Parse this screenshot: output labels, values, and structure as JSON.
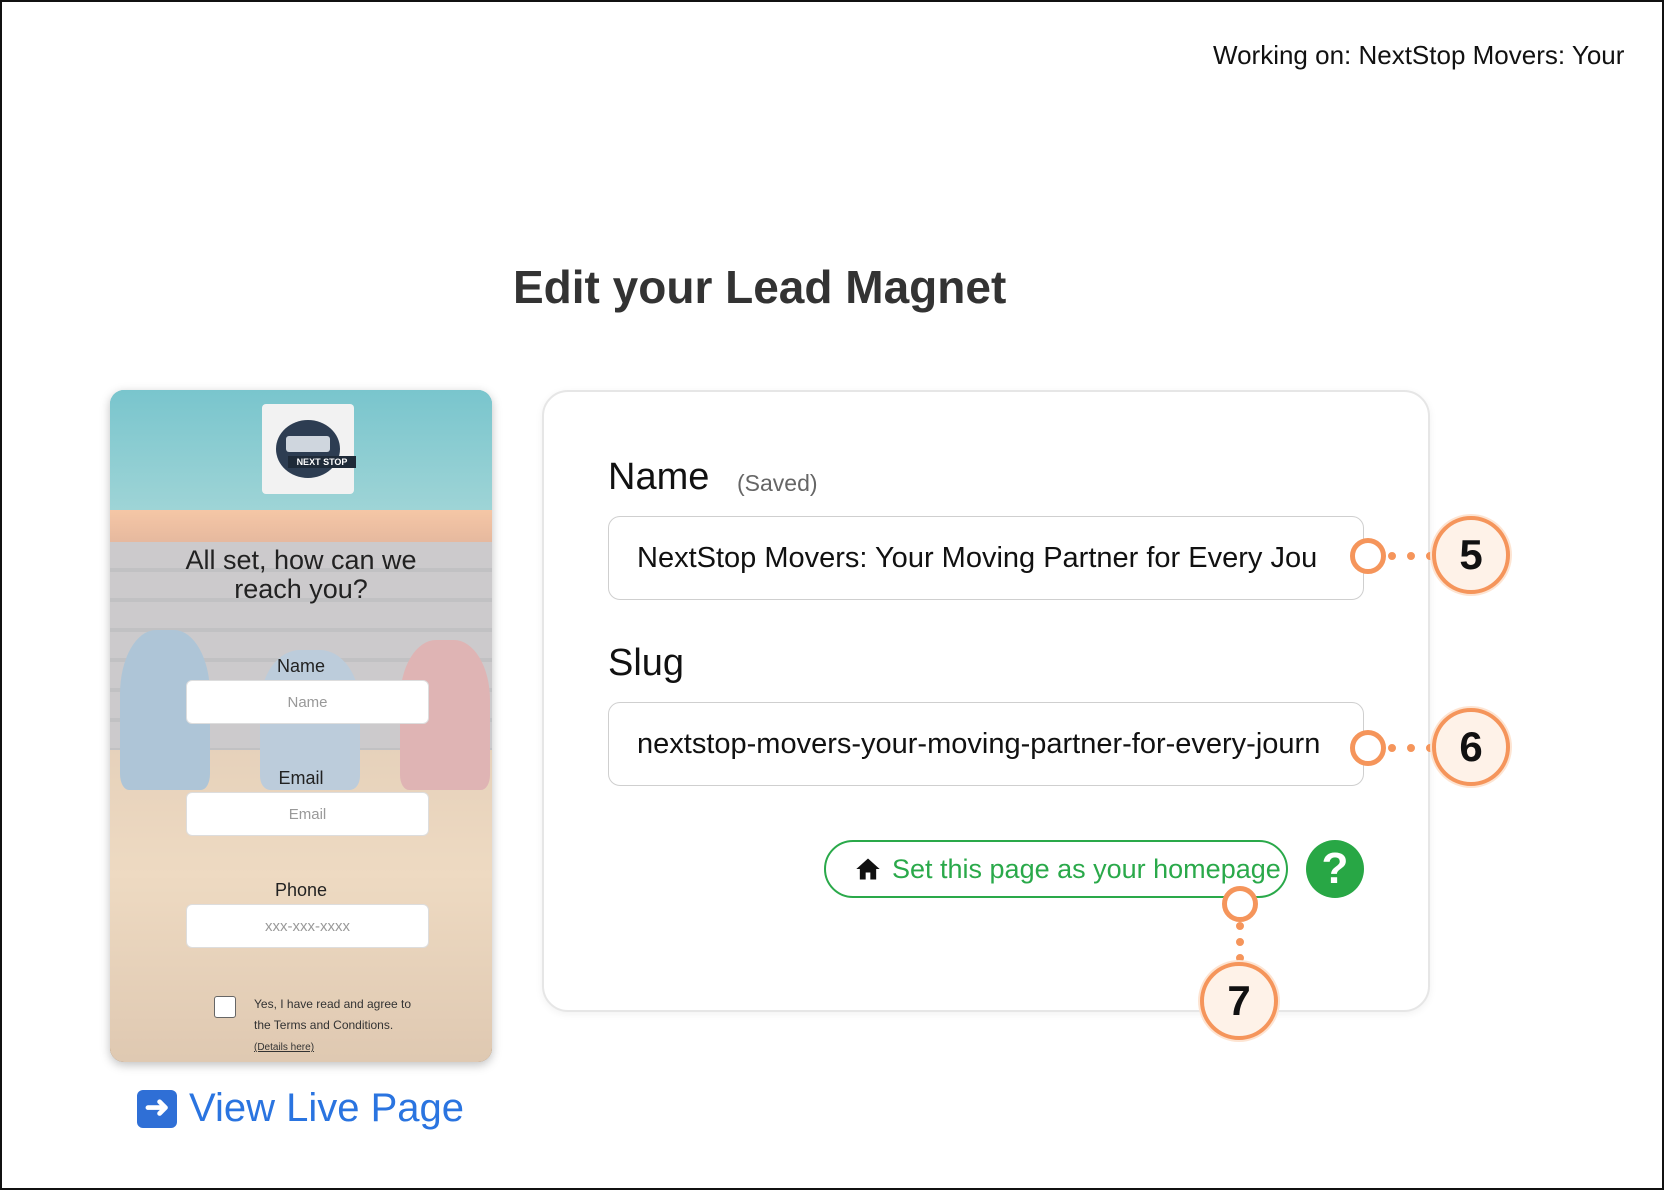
{
  "header": {
    "working_on": "Working on: NextStop Movers: Your"
  },
  "page": {
    "title": "Edit your Lead Magnet"
  },
  "preview": {
    "logo_text": "NEXT STOP",
    "heading": "All set, how can we reach you?",
    "fields": [
      {
        "label": "Name",
        "placeholder": "Name"
      },
      {
        "label": "Email",
        "placeholder": "Email"
      },
      {
        "label": "Phone",
        "placeholder": "xxx-xxx-xxxx"
      }
    ],
    "terms_text": "Yes, I have read and agree to the Terms and Conditions.",
    "terms_link": "(Details here)"
  },
  "view_live": {
    "icon": "right-arrow-icon",
    "label": "View Live Page"
  },
  "form": {
    "name_label": "Name",
    "name_status": "(Saved)",
    "name_value": "NextStop Movers: Your Moving Partner for Every Jou",
    "slug_label": "Slug",
    "slug_value": "nextstop-movers-your-moving-partner-for-every-journ",
    "homepage_button": "Set this page as your homepage",
    "help_icon": "?"
  },
  "callouts": [
    "5",
    "6",
    "7"
  ],
  "colors": {
    "accent_green": "#2aa94a",
    "link_blue": "#2a74e0",
    "callout_orange": "#f5955b"
  }
}
